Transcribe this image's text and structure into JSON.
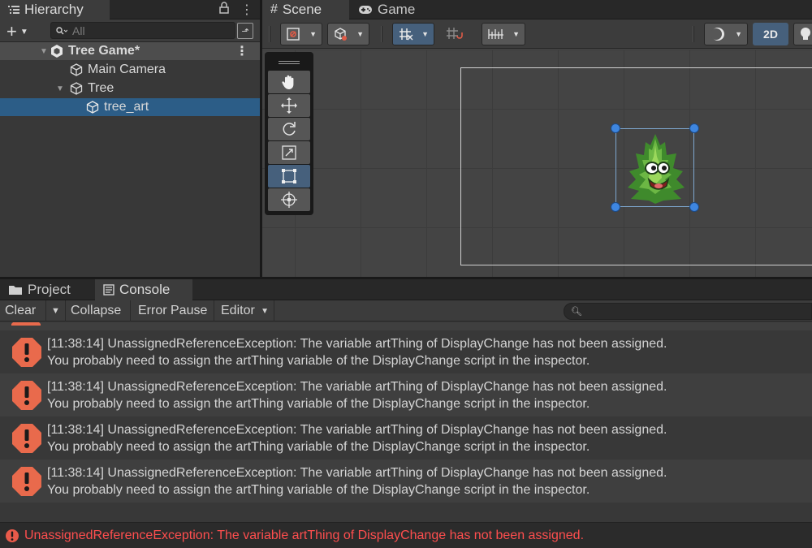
{
  "hierarchy": {
    "tab_label": "Hierarchy",
    "search_placeholder": "All",
    "scene_name": "Tree Game*",
    "items": [
      {
        "label": "Main Camera"
      },
      {
        "label": "Tree"
      },
      {
        "label": "tree_art",
        "selected": true
      }
    ]
  },
  "scene_panel": {
    "tabs": [
      {
        "label": "Scene"
      },
      {
        "label": "Game"
      }
    ],
    "mode_2d_label": "2D",
    "tools": [
      "hand",
      "move",
      "rotate",
      "scale",
      "rect",
      "transform"
    ],
    "active_tool": "rect"
  },
  "console": {
    "tabs": [
      {
        "label": "Project"
      },
      {
        "label": "Console"
      }
    ],
    "toolbar": {
      "clear": "Clear",
      "collapse": "Collapse",
      "error_pause": "Error Pause",
      "editor": "Editor"
    },
    "messages": [
      {
        "line1": "[11:38:14] UnassignedReferenceException: The variable artThing of DisplayChange has not been assigned.",
        "line2": "You probably need to assign the artThing variable of the DisplayChange script in the inspector."
      },
      {
        "line1": "[11:38:14] UnassignedReferenceException: The variable artThing of DisplayChange has not been assigned.",
        "line2": "You probably need to assign the artThing variable of the DisplayChange script in the inspector."
      },
      {
        "line1": "[11:38:14] UnassignedReferenceException: The variable artThing of DisplayChange has not been assigned.",
        "line2": "You probably need to assign the artThing variable of the DisplayChange script in the inspector."
      },
      {
        "line1": "[11:38:14] UnassignedReferenceException: The variable artThing of DisplayChange has not been assigned.",
        "line2": "You probably need to assign the artThing variable of the DisplayChange script in the inspector."
      }
    ],
    "status": "UnassignedReferenceException: The variable artThing of DisplayChange has not been assigned."
  },
  "colors": {
    "selection": "#2c5d87",
    "error_icon": "#e96a4c",
    "status_error_text": "#ff4e4e",
    "toggle_on": "#46607c"
  }
}
